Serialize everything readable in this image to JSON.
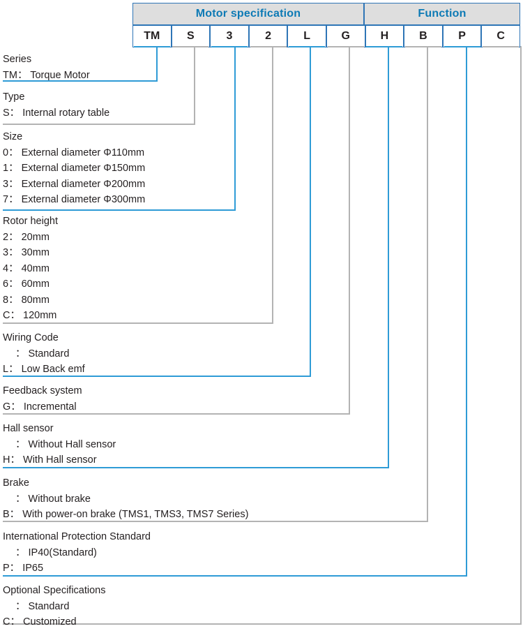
{
  "accent_blue": "#0d7ab5",
  "line_blue": "#2e9bd6",
  "line_gray": "#b3b3b3",
  "header_bg": "#dedede",
  "table": {
    "groups": [
      {
        "label": "Motor specification",
        "span": 6
      },
      {
        "label": "Function",
        "span": 5
      }
    ],
    "cells": [
      "TM",
      "S",
      "3",
      "2",
      "L",
      "G",
      "H",
      "B",
      "P",
      "C"
    ]
  },
  "sections": [
    {
      "title": "Series",
      "lines": [
        {
          "code": "TM",
          "sep": "：",
          "text": "Torque Motor"
        }
      ]
    },
    {
      "title": "Type",
      "lines": [
        {
          "code": "S",
          "sep": "：",
          "text": "Internal rotary table"
        }
      ]
    },
    {
      "title": "Size",
      "lines": [
        {
          "code": "0",
          "sep": "：",
          "text": "External diameter Φ110mm"
        },
        {
          "code": "1",
          "sep": "：",
          "text": "External diameter Φ150mm"
        },
        {
          "code": "3",
          "sep": "：",
          "text": "External diameter Φ200mm"
        },
        {
          "code": "7",
          "sep": "：",
          "text": "External diameter Φ300mm"
        }
      ]
    },
    {
      "title": "Rotor height",
      "lines": [
        {
          "code": "2",
          "sep": "：",
          "text": "20mm"
        },
        {
          "code": "3",
          "sep": "：",
          "text": "30mm"
        },
        {
          "code": "4",
          "sep": "：",
          "text": "40mm"
        },
        {
          "code": "6",
          "sep": "：",
          "text": "60mm"
        },
        {
          "code": "8",
          "sep": "：",
          "text": "80mm"
        },
        {
          "code": "C",
          "sep": "：",
          "text": "120mm"
        }
      ]
    },
    {
      "title": "Wiring Code",
      "lines": [
        {
          "code": "",
          "sep": "：",
          "text": "Standard"
        },
        {
          "code": "L",
          "sep": "：",
          "text": "Low Back emf"
        }
      ]
    },
    {
      "title": "Feedback system",
      "lines": [
        {
          "code": "G",
          "sep": "：",
          "text": "Incremental"
        }
      ]
    },
    {
      "title": "Hall sensor",
      "lines": [
        {
          "code": "",
          "sep": "：",
          "text": "Without Hall sensor"
        },
        {
          "code": "H",
          "sep": "：",
          "text": "With Hall sensor"
        }
      ]
    },
    {
      "title": "Brake",
      "lines": [
        {
          "code": "",
          "sep": "：",
          "text": "Without brake"
        },
        {
          "code": "B",
          "sep": "：",
          "text": "With power-on brake (TMS1, TMS3, TMS7 Series)"
        }
      ]
    },
    {
      "title": "International Protection Standard",
      "lines": [
        {
          "code": "",
          "sep": "：",
          "text": "IP40(Standard)"
        },
        {
          "code": "P",
          "sep": "：",
          "text": "IP65"
        }
      ]
    },
    {
      "title": "Optional Specifications",
      "lines": [
        {
          "code": "",
          "sep": "：",
          "text": "Standard"
        },
        {
          "code": "C",
          "sep": "：",
          "text": "Customized"
        }
      ]
    }
  ]
}
